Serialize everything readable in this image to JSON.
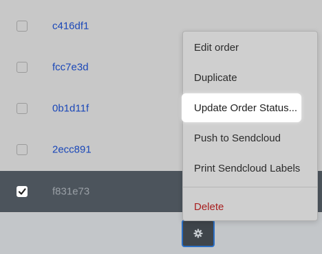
{
  "orders": [
    {
      "id": "c416df1",
      "checked": false
    },
    {
      "id": "fcc7e3d",
      "checked": false
    },
    {
      "id": "0b1d11f",
      "checked": false
    },
    {
      "id": "2ecc891",
      "checked": false
    },
    {
      "id": "f831e73",
      "checked": true
    }
  ],
  "menu": {
    "edit_order": "Edit order",
    "duplicate": "Duplicate",
    "update_status": "Update Order Status...",
    "push_sendcloud": "Push to Sendcloud",
    "print_labels": "Print Sendcloud Labels",
    "delete": "Delete"
  },
  "footer": {
    "actions_icon": "gear-icon"
  },
  "colors": {
    "link": "#1a47b8",
    "selected_row": "#4c545c",
    "danger": "#a81f1f",
    "focus": "#2a6fc6"
  }
}
